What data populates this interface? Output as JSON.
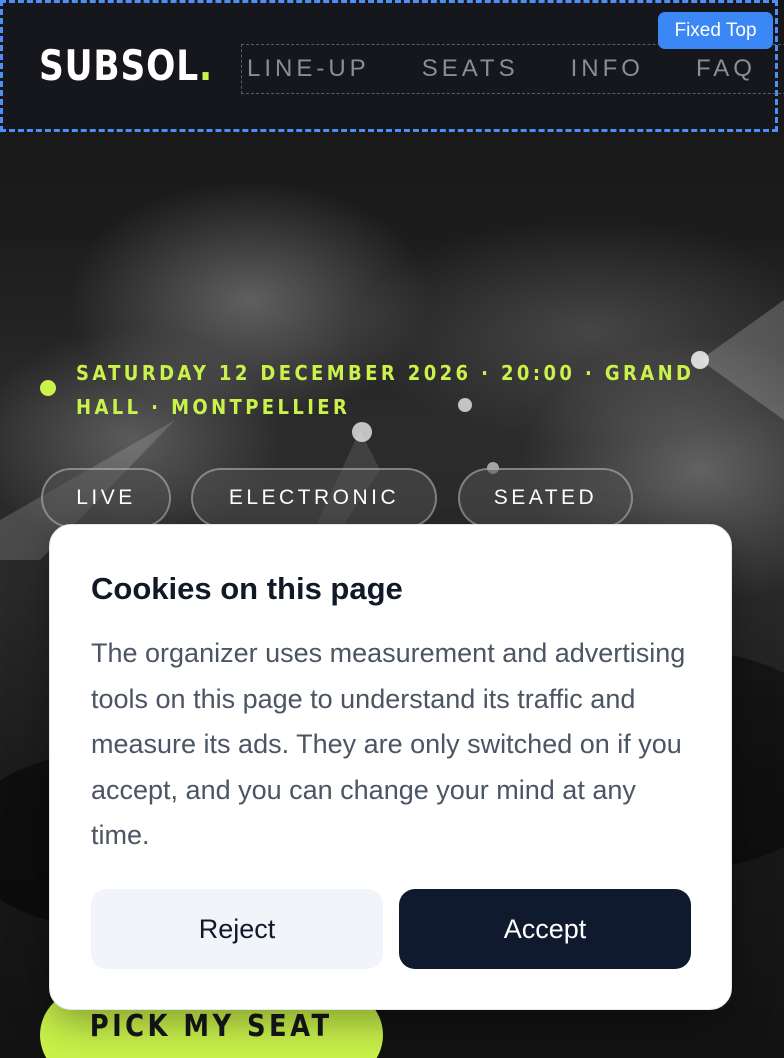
{
  "header": {
    "logo_text": "SUBSOL",
    "logo_dot": ".",
    "nav": [
      "LINE-UP",
      "SEATS",
      "INFO",
      "FAQ"
    ],
    "fixed_badge": "Fixed Top"
  },
  "hero": {
    "event_line": "SATURDAY 12 DECEMBER 2026 · 20:00 · GRAND HALL · MONTPELLIER",
    "tags": [
      "LIVE",
      "ELECTRONIC",
      "SEATED"
    ],
    "cta_label": "PICK MY SEAT"
  },
  "cookie": {
    "title": "Cookies on this page",
    "body": "The organizer uses measurement and advertising tools on this page to understand its traffic and measure its ads. They are only switched on if you accept, and you can change your mind at any time.",
    "reject_label": "Reject",
    "accept_label": "Accept"
  },
  "colors": {
    "accent": "#c9f24a",
    "header_bg": "#16171c",
    "badge": "#3b87f5",
    "accept_bg": "#101a2f",
    "reject_bg": "#f1f4f9"
  }
}
